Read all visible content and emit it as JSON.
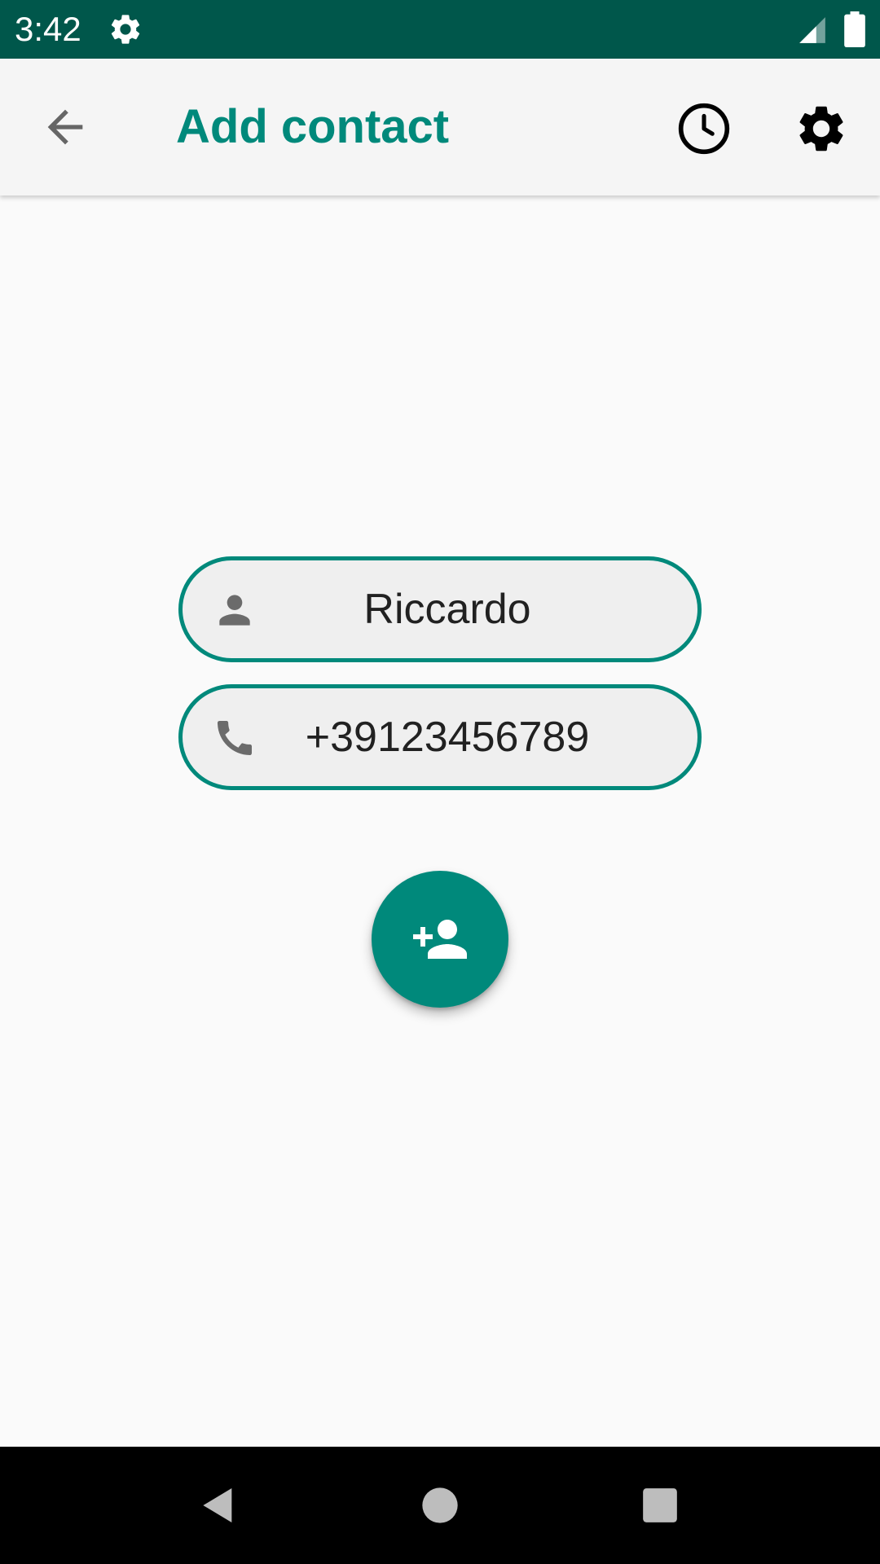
{
  "status_bar": {
    "time": "3:42",
    "background_color": "#00574b",
    "icons": [
      "gear-icon",
      "signal-icon",
      "battery-icon"
    ]
  },
  "app_bar": {
    "title": "Add contact",
    "title_color": "#00897b",
    "back_icon": "arrow-back-icon",
    "actions": [
      "history-icon",
      "settings-icon"
    ]
  },
  "form": {
    "name": {
      "icon": "person-icon",
      "value": "Riccardo"
    },
    "phone": {
      "icon": "phone-icon",
      "value": "+39123456789"
    },
    "accent_color": "#00897b"
  },
  "fab": {
    "icon": "add-person-icon",
    "color": "#00897b"
  },
  "nav_bar": {
    "buttons": [
      "back-triangle-icon",
      "home-circle-icon",
      "recents-square-icon"
    ]
  }
}
